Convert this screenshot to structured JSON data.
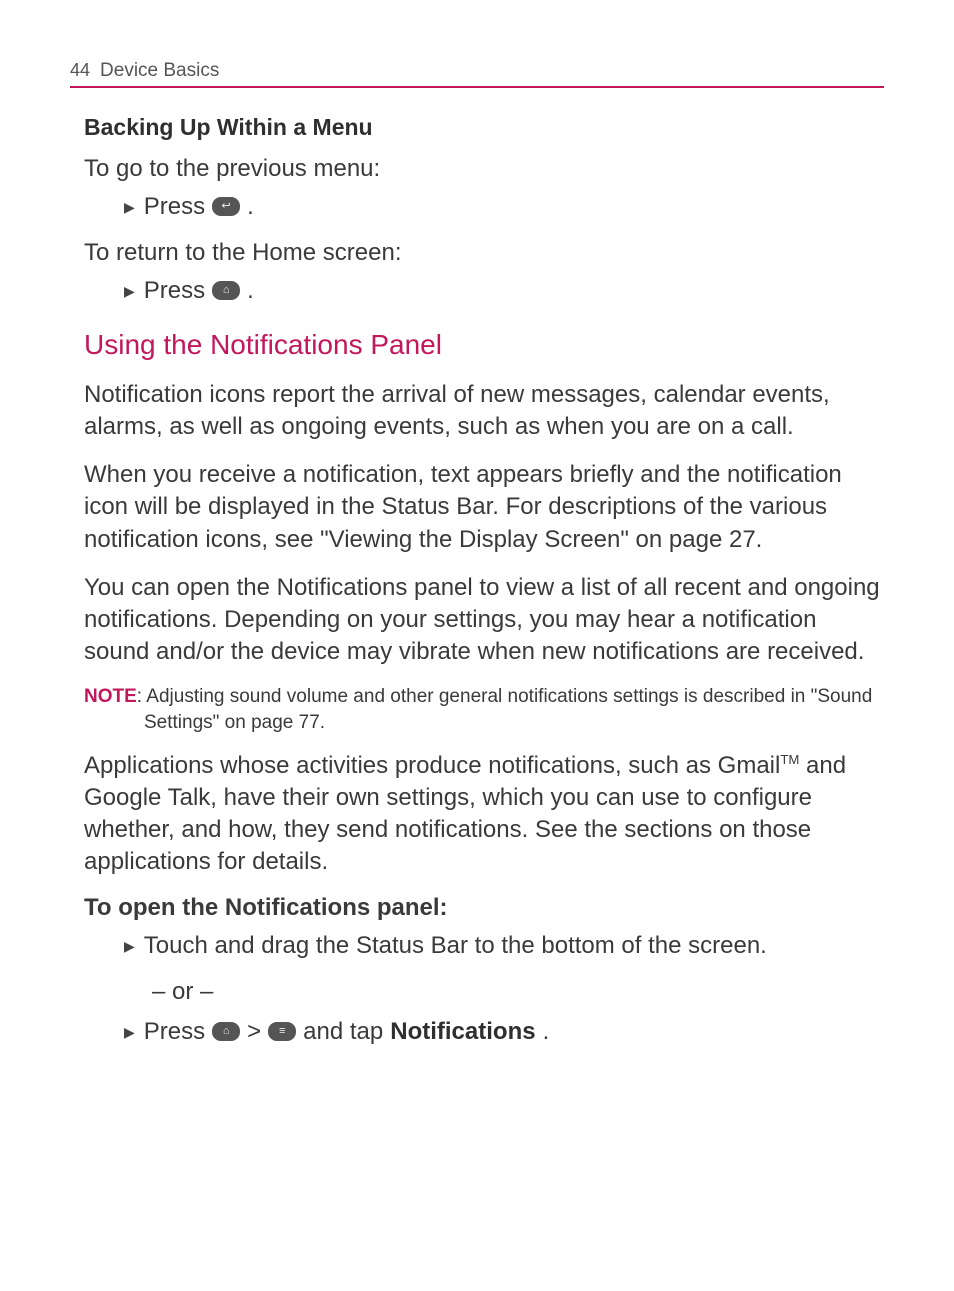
{
  "header": {
    "page_number": "44",
    "section": "Device Basics"
  },
  "s1": {
    "title": "Backing Up Within a Menu",
    "prev_menu_intro": "To go to the previous menu:",
    "press_word": "Press",
    "home_intro": "To return to the Home screen:"
  },
  "s2": {
    "heading": "Using the Notifications Panel",
    "p1": "Notification icons report the arrival of new messages, calendar events, alarms, as well as ongoing events, such as when you are on a call.",
    "p2": "When you receive a notification, text appears briefly and the notification icon will be displayed in the Status Bar. For descriptions of the various notification icons, see \"Viewing the Display Screen\" on page 27.",
    "p3": "You can open the Notifications panel to view a list of all recent and ongoing notifications. Depending on your settings, you may hear a notification sound and/or the device may vibrate when new notifications are received.",
    "note_label": "NOTE",
    "note_text": ": Adjusting sound volume and other general notifications settings is described in \"Sound Settings\" on page 77.",
    "p4_pre": "Applications whose activities produce notifications, such as Gmail",
    "p4_tm": "TM",
    "p4_post": " and Google Talk, have their own settings, which you can use to configure whether, and how, they send notifications. See the sections on those applications for details.",
    "open_title": "To open the Notifications panel:",
    "b1": "Touch and drag the Status Bar to the bottom of the screen.",
    "or": "– or –",
    "b2_press": "Press",
    "b2_sep": ">",
    "b2_mid": "and tap",
    "b2_bold": "Notifications",
    "b2_end": "."
  }
}
